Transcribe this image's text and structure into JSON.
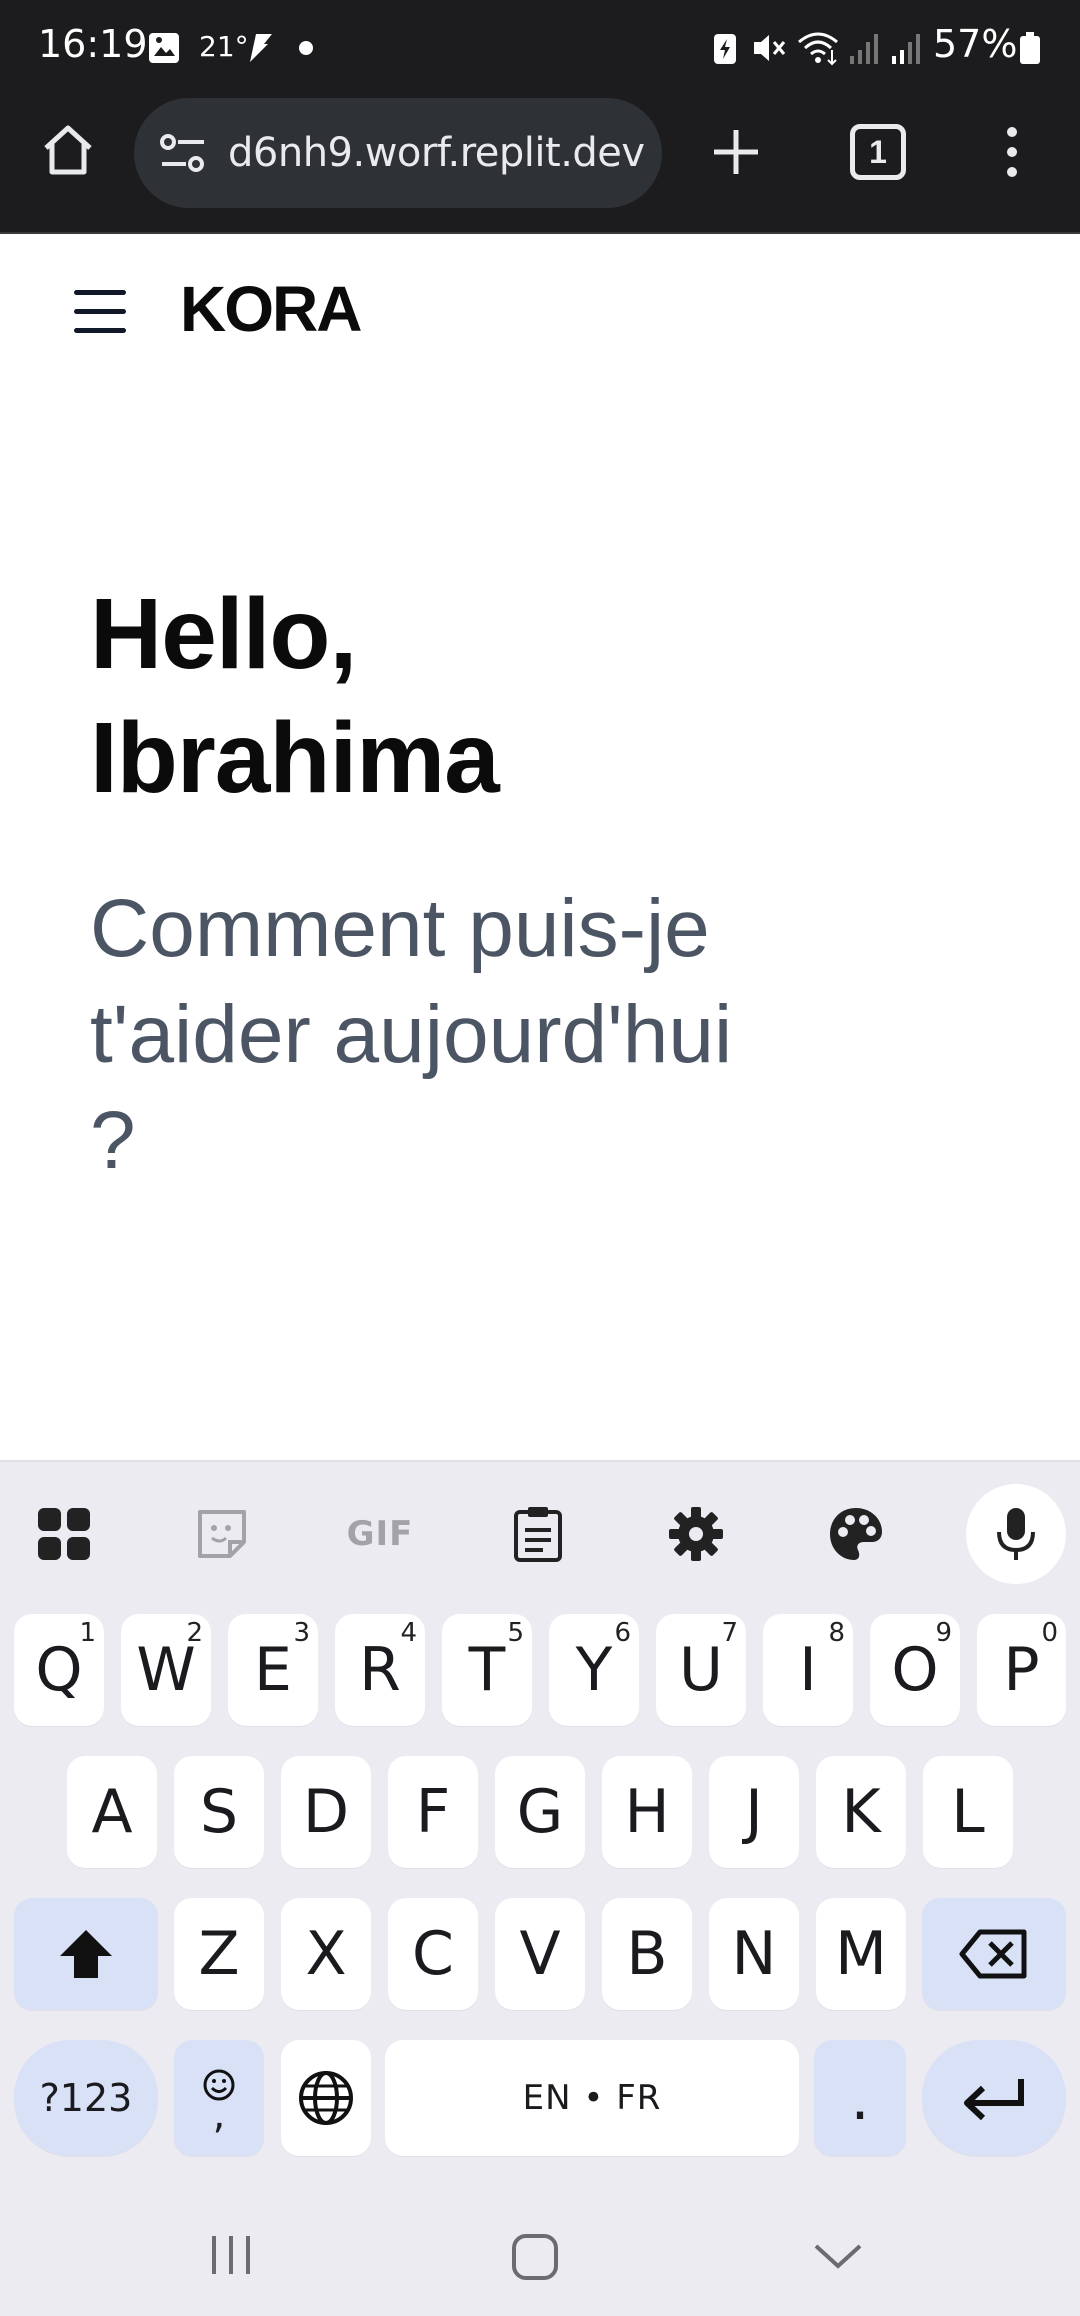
{
  "status_bar": {
    "time": "16:19",
    "temperature": "21°",
    "battery": "57%",
    "icons": [
      "gallery-icon",
      "weather-icon",
      "signal-app-icon",
      "dot-icon",
      "battery-saver-icon",
      "mute-icon",
      "wifi-icon",
      "cell-signal-icon",
      "cell-signal-icon",
      "battery-icon"
    ]
  },
  "browser": {
    "url": "d6nh9.worf.replit.dev",
    "tab_count": "1",
    "icons": [
      "home-icon",
      "site-settings-icon",
      "new-tab-icon",
      "tab-switcher-icon",
      "more-menu-icon"
    ]
  },
  "app": {
    "brand": "KORA",
    "greeting_line1": "Hello,",
    "greeting_line2": "Ibrahima",
    "subtitle": "Comment puis-je t'aider aujourd'hui ?"
  },
  "keyboard": {
    "toolbar": [
      "apps-grid-icon",
      "sticker-icon",
      "GIF",
      "clipboard-icon",
      "settings-gear-icon",
      "palette-icon",
      "microphone-icon"
    ],
    "gif_label": "GIF",
    "row1": [
      {
        "k": "Q",
        "s": "1"
      },
      {
        "k": "W",
        "s": "2"
      },
      {
        "k": "E",
        "s": "3"
      },
      {
        "k": "R",
        "s": "4"
      },
      {
        "k": "T",
        "s": "5"
      },
      {
        "k": "Y",
        "s": "6"
      },
      {
        "k": "U",
        "s": "7"
      },
      {
        "k": "I",
        "s": "8"
      },
      {
        "k": "O",
        "s": "9"
      },
      {
        "k": "P",
        "s": "0"
      }
    ],
    "row2": [
      "A",
      "S",
      "D",
      "F",
      "G",
      "H",
      "J",
      "K",
      "L"
    ],
    "row3": [
      "Z",
      "X",
      "C",
      "V",
      "B",
      "N",
      "M"
    ],
    "symbols_key": "?123",
    "emoji_key_sub": ",",
    "space_label": "EN • FR",
    "period_key": ".",
    "special_key_color": "#d9e1f7"
  },
  "nav_bar": {
    "icons": [
      "recent-apps-icon",
      "home-button-icon",
      "back-icon"
    ]
  }
}
